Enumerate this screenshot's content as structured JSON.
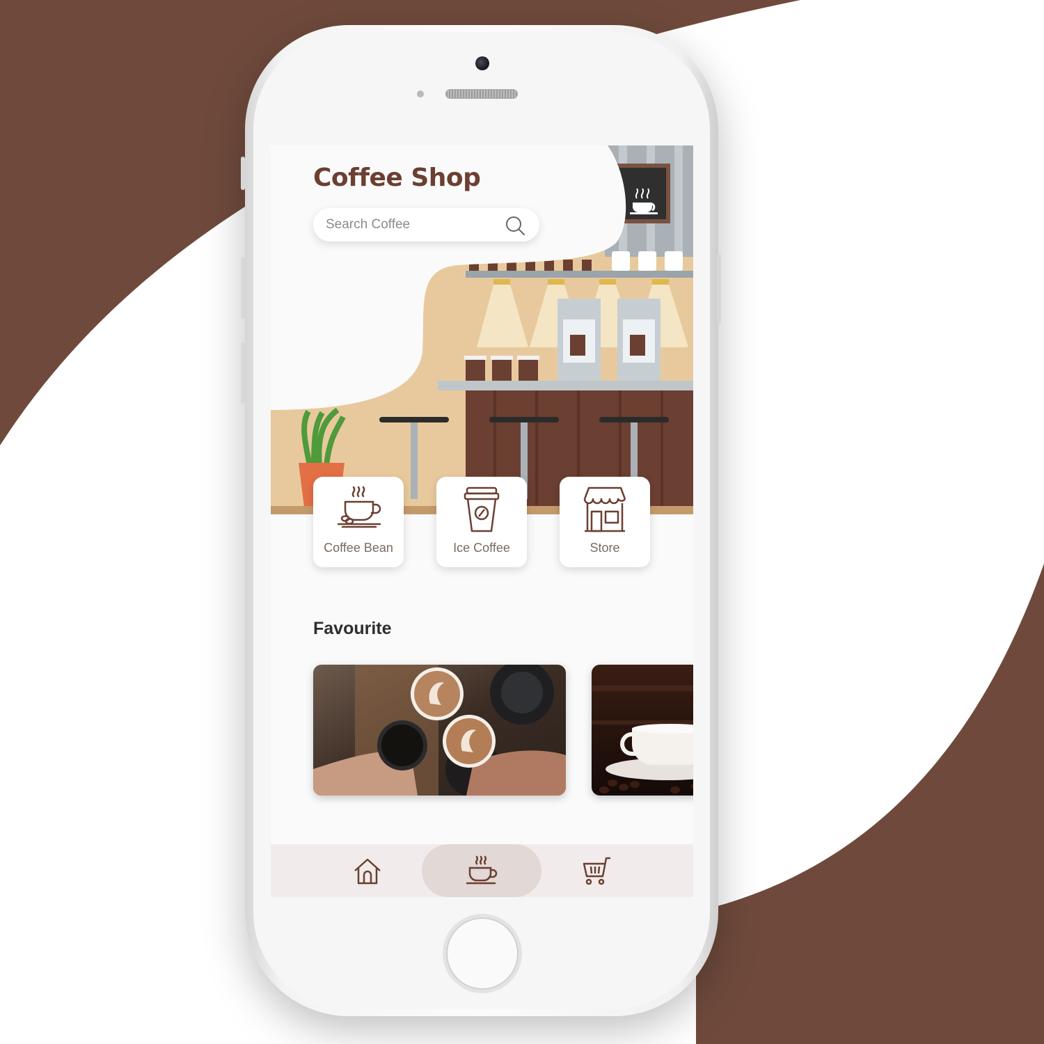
{
  "app": {
    "title": "Coffee Shop"
  },
  "search": {
    "placeholder": "Search Coffee",
    "value": "",
    "icon": "search-icon"
  },
  "categories": [
    {
      "label": "Coffee Bean",
      "icon": "coffee-cup-icon"
    },
    {
      "label": "Ice Coffee",
      "icon": "takeaway-cup-icon"
    },
    {
      "label": "Store",
      "icon": "store-icon"
    }
  ],
  "favourite": {
    "title": "Favourite",
    "items": [
      {
        "image": "latte-toast-photo"
      },
      {
        "image": "coffee-cup-saucer-photo"
      }
    ]
  },
  "bottom_nav": {
    "items": [
      {
        "icon": "home-icon",
        "active": false
      },
      {
        "icon": "coffee-cup-icon",
        "active": true
      },
      {
        "icon": "cart-icon",
        "active": false
      }
    ]
  },
  "colors": {
    "brand_brown": "#6f4a3c",
    "title_brown": "#6b3f31",
    "nav_background": "#f1eceb",
    "nav_active": "#e2d8d5"
  }
}
